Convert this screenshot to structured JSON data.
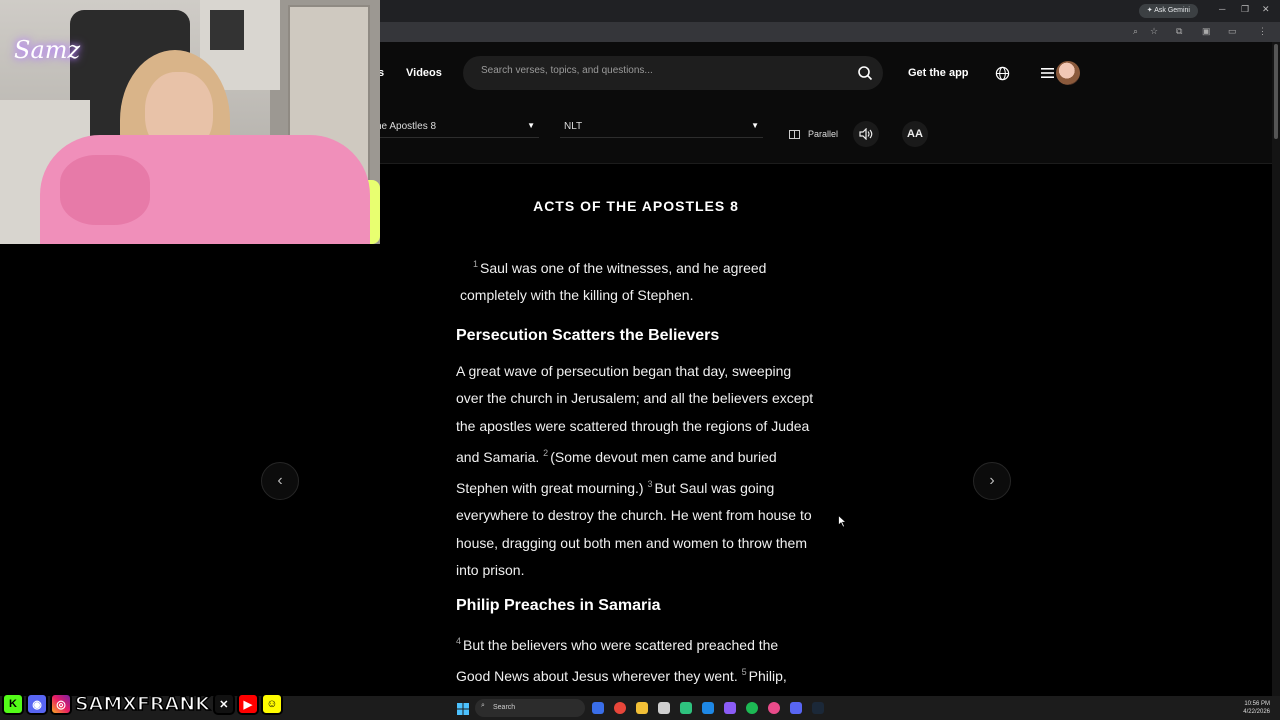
{
  "browser": {
    "gemini_label": "Ask Gemini"
  },
  "nav": {
    "partial_link": "s",
    "videos_link": "Videos",
    "search_placeholder": "Search verses, topics, and questions...",
    "get_app": "Get the app"
  },
  "reader": {
    "book_select": "he Apostles 8",
    "version_select": "NLT",
    "parallel_label": "Parallel",
    "font_button": "AA"
  },
  "content": {
    "chapter_title": "ACTS OF THE APOSTLES 8",
    "v1_num": "1",
    "v1_text": "Saul was one of the witnesses, and he agreed completely with the killing of Stephen.",
    "heading1": "Persecution Scatters the Believers",
    "p2_text_a": "A great wave of persecution began that day, sweeping over the church in Jerusalem; and all the believers except the apostles were scattered through the regions of Judea and Samaria.",
    "v2_num": "2",
    "v2_text": "(Some devout men came and buried Stephen with great mourning.)",
    "v3_num": "3",
    "v3_text": "But Saul was going everywhere to destroy the church. He went from house to house, dragging out both men and women to throw them into prison.",
    "heading2": "Philip Preaches in Samaria",
    "v4_num": "4",
    "v4_text": "But the believers who were scattered preached the Good News about Jesus wherever they went.",
    "v5_num": "5",
    "v5_text": "Philip, for example, went to the city of Samaria and told the"
  },
  "overlay": {
    "handle": "SAMXFRANK",
    "webcam_logo": "Samz"
  },
  "taskbar": {
    "search_label": "Search",
    "time": "10:56 PM",
    "date": "4/22/2026"
  }
}
